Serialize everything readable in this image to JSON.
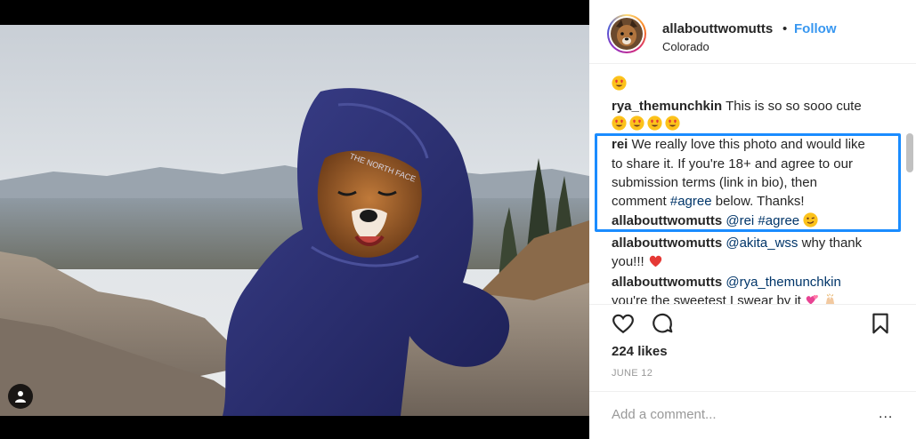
{
  "post": {
    "username": "allabouttwomutts",
    "separator": "•",
    "follow_label": "Follow",
    "location": "Colorado"
  },
  "comments": [
    {
      "user": "",
      "text": "",
      "emoji": [
        "heart-eyes"
      ]
    },
    {
      "user": "rya_themunchkin",
      "text": "This is so so sooo cute",
      "emoji": [
        "heart-eyes",
        "heart-eyes",
        "heart-eyes",
        "heart-eyes"
      ]
    },
    {
      "user": "rei",
      "text_lines": [
        "We really love this photo and would like",
        "to share it. If you're 18+ and agree to our",
        "submission terms (link in bio), then"
      ],
      "line4_prefix": "comment ",
      "hashtag": "#agree",
      "line4_suffix": " below. Thanks!"
    },
    {
      "user": "allabouttwomutts",
      "mention": "@rei",
      "hashtag": "#agree",
      "emoji": [
        "wink"
      ]
    },
    {
      "user": "allabouttwomutts",
      "mention": "@akita_wss",
      "text": "why thank",
      "text2": "you!!!",
      "emoji": [
        "red-heart"
      ]
    },
    {
      "user": "allabouttwomutts",
      "mention": "@rya_themunchkin",
      "text2": "you're the sweetest I swear by it",
      "emoji": [
        "hearts",
        "hands"
      ]
    }
  ],
  "likes": "224 likes",
  "date": "JUNE 12",
  "add_comment": {
    "placeholder": "Add a comment...",
    "more": "..."
  },
  "icons": [
    "tag-user-icon",
    "heart-icon",
    "comment-icon",
    "bookmark-icon",
    "more-icon"
  ],
  "colors": {
    "link": "#3897f0",
    "highlight": "#1a8cff",
    "mention": "#003569",
    "heart": "#ed4956"
  }
}
